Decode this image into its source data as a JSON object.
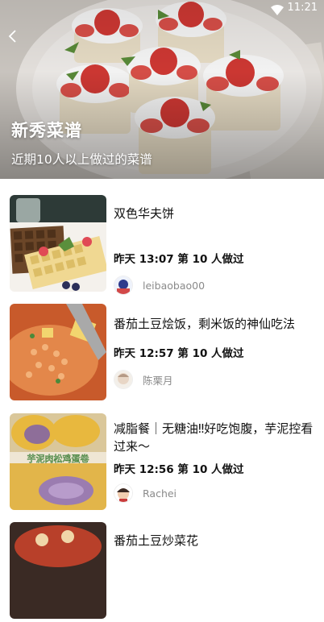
{
  "status_bar": {
    "time": "11:21",
    "wifi_icon": "wifi-icon"
  },
  "header": {
    "back_icon": "chevron-left-icon",
    "title": "新秀菜谱",
    "subtitle": "近期10人以上做过的菜谱"
  },
  "recipes": [
    {
      "title": "双色华夫饼",
      "meta": "昨天 13:07 第 10 人做过",
      "author": "leibaobao00"
    },
    {
      "title": "番茄土豆烩饭，剩米饭的神仙吃法",
      "meta": "昨天 12:57 第 10 人做过",
      "author": "陈栗月"
    },
    {
      "title": "减脂餐｜无糖油‼好吃饱腹，芋泥控看过来～",
      "meta": "昨天 12:56 第 10 人做过",
      "author": "Rachei"
    },
    {
      "title": "番茄土豆炒菜花"
    }
  ],
  "thumb_text": {
    "taro_roll": "芋泥肉松鸡蛋卷"
  }
}
